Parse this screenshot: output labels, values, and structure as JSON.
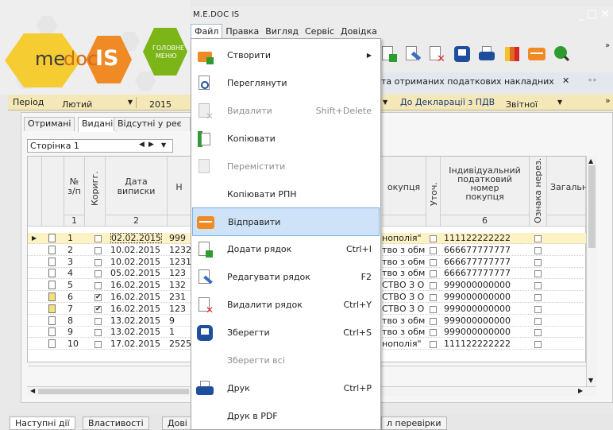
{
  "app": {
    "window_title": "M.E.DOC IS",
    "logo_me": "me",
    "logo_doc": "doc",
    "logo_is": "IS",
    "main_menu_line1": "ГОЛОВНЕ",
    "main_menu_line2": "МЕНЮ"
  },
  "menubar": [
    "Файл",
    "Правка",
    "Вигляд",
    "Сервіс",
    "Довідка"
  ],
  "document_tab": {
    "label": "та отриманих податкових накладних",
    "close": "✕",
    "nav": "◂ ▸"
  },
  "filter": {
    "period_label": "Період",
    "month": "Лютий",
    "year": "2015",
    "declaration": "До Декларації з ПДВ",
    "report_type": "Звітної"
  },
  "subtabs": [
    "Отримані",
    "Видані",
    "Відсутні у реє"
  ],
  "pager": {
    "value": "Сторінка 1"
  },
  "grid": {
    "headers": {
      "num": "№\nз/п",
      "corrected": "Коригг.",
      "date": "Дата\nвиписки",
      "n": "Н",
      "buyer": "окупця",
      "clarif": "Уточ.",
      "ipn": "Індивідуальний\nподатковий\nномер\nпокупця",
      "nonres": "Ознака нерез.",
      "total": "Загальн"
    },
    "col_numbers": {
      "num": "1",
      "date": "2",
      "ipn": "6"
    },
    "rows": [
      {
        "num": "1",
        "checked": false,
        "date": "02.02.2015",
        "n": "999",
        "buyer": "нополія\"",
        "ipn": "111122222222"
      },
      {
        "num": "2",
        "checked": false,
        "date": "10.02.2015",
        "n": "1232",
        "buyer": "тво з обм",
        "ipn": "666677777777"
      },
      {
        "num": "3",
        "checked": false,
        "date": "10.02.2015",
        "n": "1231",
        "buyer": "тво з обм",
        "ipn": "666677777777"
      },
      {
        "num": "4",
        "checked": false,
        "date": "05.02.2015",
        "n": "123",
        "buyer": "тво з обм",
        "ipn": "666677777777"
      },
      {
        "num": "5",
        "checked": false,
        "date": "16.02.2015",
        "n": "132",
        "buyer": "СТВО З О",
        "ipn": "999000000000"
      },
      {
        "num": "6",
        "checked": true,
        "date": "16.02.2015",
        "n": "231",
        "buyer": "СТВО З О",
        "ipn": "999000000000"
      },
      {
        "num": "7",
        "checked": true,
        "date": "16.02.2015",
        "n": "123",
        "buyer": "СТВО З О",
        "ipn": "999000000000"
      },
      {
        "num": "8",
        "checked": false,
        "date": "13.02.2015",
        "n": "9",
        "buyer": "тво з обм",
        "ipn": "999000000000"
      },
      {
        "num": "9",
        "checked": false,
        "date": "13.02.2015",
        "n": "1",
        "buyer": "тво з обм",
        "ipn": "999000000000"
      },
      {
        "num": "10",
        "checked": false,
        "date": "17.02.2015",
        "n": "2525",
        "buyer": "нополія\"",
        "ipn": "111122222222"
      }
    ]
  },
  "bottom_tabs": [
    "Наступні дії",
    "Властивості",
    "Дові",
    "л перевірки"
  ],
  "file_menu": [
    {
      "label": "Створити",
      "shortcut": "",
      "submenu": true,
      "disabled": false,
      "icon": "create-folder-icon"
    },
    {
      "label": "Переглянути",
      "shortcut": "",
      "disabled": false,
      "icon": "view-document-icon"
    },
    {
      "label": "Видалити",
      "shortcut": "Shift+Delete",
      "disabled": true,
      "icon": "delete-document-icon"
    },
    {
      "label": "Копіювати",
      "shortcut": "",
      "disabled": false,
      "icon": "copy-icon"
    },
    {
      "label": "Перемістити",
      "shortcut": "",
      "disabled": true,
      "icon": "move-icon"
    },
    {
      "label": "Копіювати РПН",
      "shortcut": "",
      "disabled": false,
      "icon": ""
    },
    {
      "label": "Відправити",
      "shortcut": "",
      "disabled": false,
      "highlighted": true,
      "icon": "send-envelope-icon"
    },
    {
      "label": "Додати рядок",
      "shortcut": "Ctrl+I",
      "disabled": false,
      "icon": "add-row-icon"
    },
    {
      "label": "Редагувати рядок",
      "shortcut": "F2",
      "disabled": false,
      "icon": "edit-row-icon"
    },
    {
      "label": "Видалити рядок",
      "shortcut": "Ctrl+Y",
      "disabled": false,
      "icon": "delete-row-icon"
    },
    {
      "label": "Зберегти",
      "shortcut": "Ctrl+S",
      "disabled": false,
      "icon": "save-icon"
    },
    {
      "label": "Зберегти всі",
      "shortcut": "",
      "disabled": true,
      "icon": ""
    },
    {
      "label": "Друк",
      "shortcut": "Ctrl+P",
      "disabled": false,
      "icon": "printer-icon"
    },
    {
      "label": "Друк в PDF",
      "shortcut": "",
      "disabled": false,
      "icon": ""
    }
  ],
  "colors": {
    "accent_orange": "#f08a24",
    "brand_green": "#7cb518",
    "highlight": "#cfe3f8",
    "filter_bg": "#f4e8b8",
    "selected_row": "#fdf2c4"
  }
}
